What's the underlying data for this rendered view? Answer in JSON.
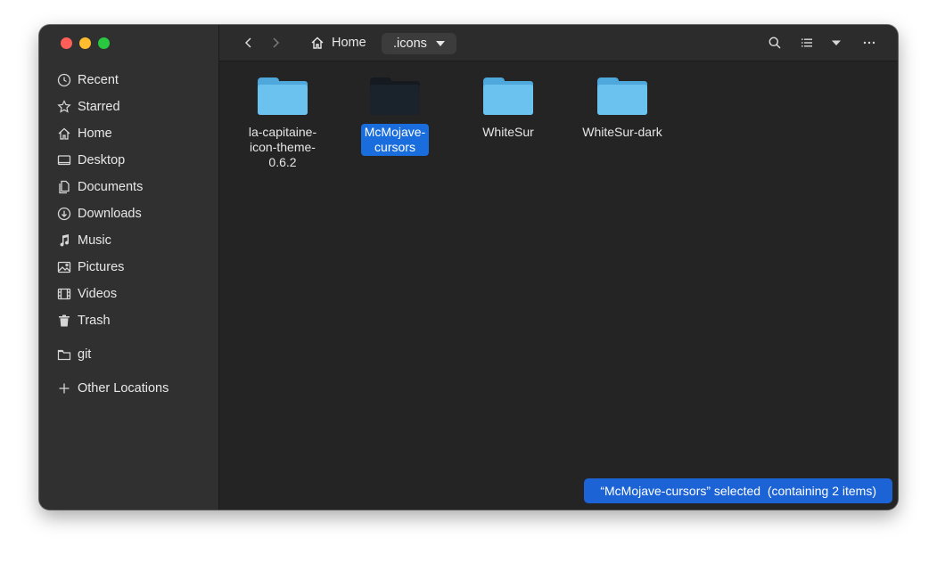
{
  "sidebar": {
    "items": [
      {
        "label": "Recent",
        "icon": "clock-icon"
      },
      {
        "label": "Starred",
        "icon": "star-icon"
      },
      {
        "label": "Home",
        "icon": "home-icon"
      },
      {
        "label": "Desktop",
        "icon": "desktop-icon"
      },
      {
        "label": "Documents",
        "icon": "documents-icon"
      },
      {
        "label": "Downloads",
        "icon": "downloads-icon"
      },
      {
        "label": "Music",
        "icon": "music-icon"
      },
      {
        "label": "Pictures",
        "icon": "pictures-icon"
      },
      {
        "label": "Videos",
        "icon": "videos-icon"
      },
      {
        "label": "Trash",
        "icon": "trash-icon"
      }
    ],
    "bookmarks": [
      {
        "label": "git",
        "icon": "folder-icon"
      }
    ],
    "other": {
      "label": "Other Locations",
      "icon": "plus-icon"
    }
  },
  "header": {
    "home_label": "Home",
    "current_folder": ".icons"
  },
  "files": [
    {
      "name": "la-capitaine-icon-theme-0.6.2",
      "line1": "la-capitaine-",
      "line2": "icon-theme-",
      "line3": "0.6.2",
      "selected": false
    },
    {
      "name": "McMojave-cursors",
      "line1": "McMojave-",
      "line2": "cursors",
      "line3": "",
      "selected": true
    },
    {
      "name": "WhiteSur",
      "line1": "WhiteSur",
      "line2": "",
      "line3": "",
      "selected": false
    },
    {
      "name": "WhiteSur-dark",
      "line1": "WhiteSur-dark",
      "line2": "",
      "line3": "",
      "selected": false
    }
  ],
  "status": "“McMojave-cursors” selected  (containing 2 items)",
  "colors": {
    "accent": "#1a6ddd",
    "folder": "#6cc2ee",
    "window_bg": "#242424",
    "sidebar_bg": "#303030"
  }
}
